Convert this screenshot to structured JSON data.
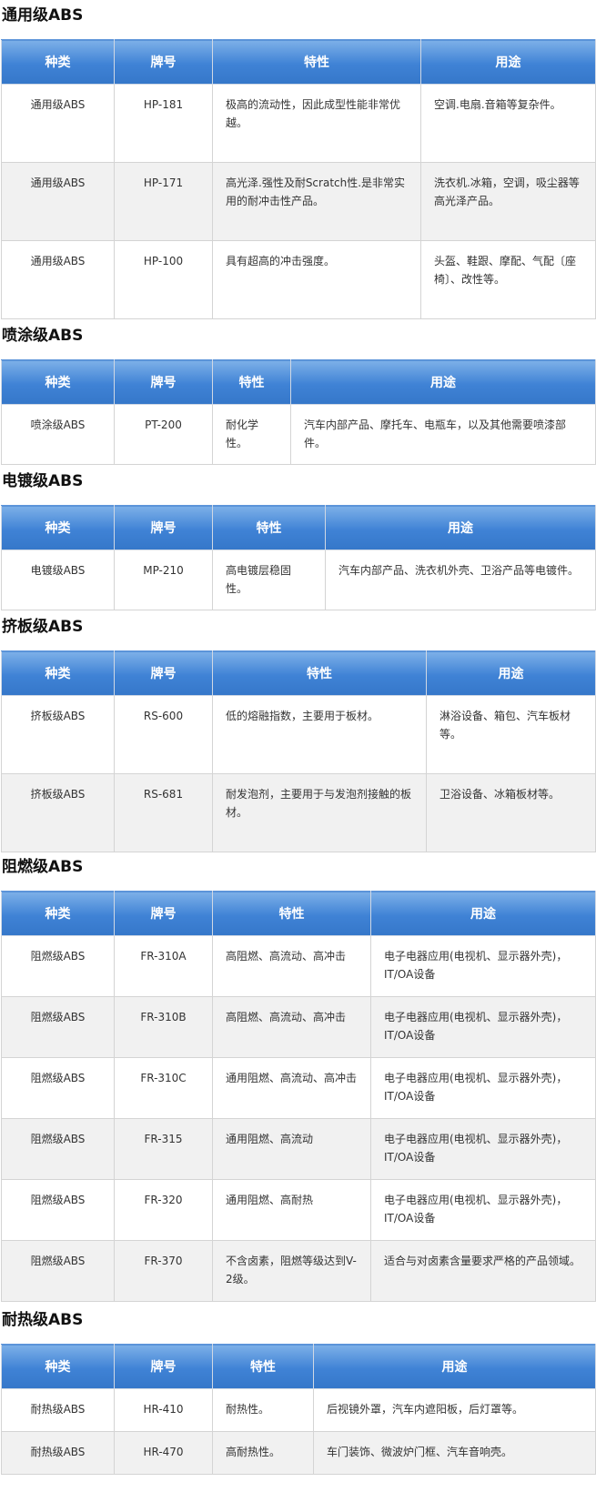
{
  "header": {
    "kind": "种类",
    "grade": "牌号",
    "property": "特性",
    "use": "用途"
  },
  "sections": [
    {
      "title": "通用级ABS",
      "rows": [
        {
          "kind": "通用级ABS",
          "grade": "HP-181",
          "property": "极高的流动性，因此成型性能非常优越。",
          "use": "空调.电扇.音箱等复杂件。"
        },
        {
          "kind": "通用级ABS",
          "grade": "HP-171",
          "property": "高光泽.强性及耐Scratch性.是非常实用的耐冲击性产品。",
          "use": "洗衣机.冰箱，空调，吸尘器等高光泽产品。"
        },
        {
          "kind": "通用级ABS",
          "grade": "HP-100",
          "property": "具有超高的冲击强度。",
          "use": "头盔、鞋跟、摩配、气配〔座椅〕、改性等。"
        }
      ]
    },
    {
      "title": "喷涂级ABS",
      "rows": [
        {
          "kind": "喷涂级ABS",
          "grade": "PT-200",
          "property": "耐化学性。",
          "use": "汽车内部产品、摩托车、电瓶车，以及其他需要喷漆部件。"
        }
      ]
    },
    {
      "title": "电镀级ABS",
      "rows": [
        {
          "kind": "电镀级ABS",
          "grade": "MP-210",
          "property": "高电镀层稳固性。",
          "use": "汽车内部产品、洗衣机外壳、卫浴产品等电镀件。"
        }
      ]
    },
    {
      "title": "挤板级ABS",
      "rows": [
        {
          "kind": "挤板级ABS",
          "grade": "RS-600",
          "property": "低的熔融指数，主要用于板材。",
          "use": "淋浴设备、箱包、汽车板材等。"
        },
        {
          "kind": "挤板级ABS",
          "grade": "RS-681",
          "property": "耐发泡剂，主要用于与发泡剂接触的板材。",
          "use": "卫浴设备、冰箱板材等。"
        }
      ]
    },
    {
      "title": "阻燃级ABS",
      "rows": [
        {
          "kind": "阻燃级ABS",
          "grade": "FR-310A",
          "property": "高阻燃、高流动、高冲击",
          "use": "电子电器应用(电视机、显示器外壳)，IT/OA设备"
        },
        {
          "kind": "阻燃级ABS",
          "grade": "FR-310B",
          "property": "高阻燃、高流动、高冲击",
          "use": "电子电器应用(电视机、显示器外壳)，IT/OA设备"
        },
        {
          "kind": "阻燃级ABS",
          "grade": "FR-310C",
          "property": "通用阻燃、高流动、高冲击",
          "use": "电子电器应用(电视机、显示器外壳)，IT/OA设备"
        },
        {
          "kind": "阻燃级ABS",
          "grade": "FR-315",
          "property": "通用阻燃、高流动",
          "use": "电子电器应用(电视机、显示器外壳)，IT/OA设备"
        },
        {
          "kind": "阻燃级ABS",
          "grade": "FR-320",
          "property": "通用阻燃、高耐热",
          "use": "电子电器应用(电视机、显示器外壳)，IT/OA设备"
        },
        {
          "kind": "阻燃级ABS",
          "grade": "FR-370",
          "property": "不含卤素，阻燃等级达到V-2级。",
          "use": "适合与对卤素含量要求严格的产品领域。"
        }
      ]
    },
    {
      "title": "耐热级ABS",
      "rows": [
        {
          "kind": "耐热级ABS",
          "grade": "HR-410",
          "property": "耐热性。",
          "use": "后视镜外罩，汽车内遮阳板，后灯罩等。"
        },
        {
          "kind": "耐热级ABS",
          "grade": "HR-470",
          "property": "高耐热性。",
          "use": "车门装饰、微波炉门框、汽车音响壳。"
        }
      ]
    }
  ]
}
